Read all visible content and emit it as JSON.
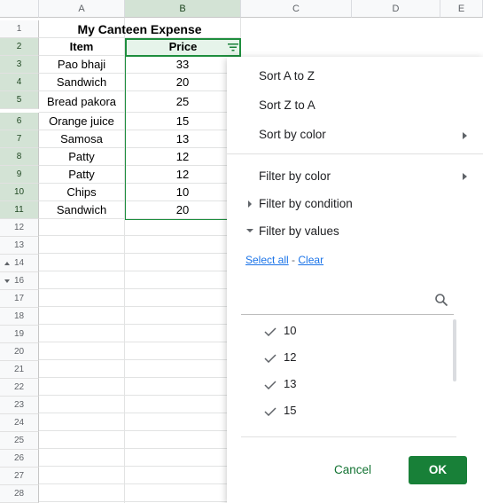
{
  "columns": [
    "A",
    "B",
    "C",
    "D",
    "E"
  ],
  "row_numbers": [
    "1",
    "2",
    "3",
    "4",
    "5",
    "6",
    "7",
    "8",
    "9",
    "10",
    "11",
    "12",
    "13",
    "14",
    "16",
    "17",
    "18",
    "19",
    "20",
    "21",
    "22",
    "23",
    "24",
    "25",
    "26",
    "27",
    "28"
  ],
  "sheet": {
    "title": "My Canteen Expense",
    "headers": {
      "item": "Item",
      "price": "Price"
    },
    "rows": [
      {
        "item": "Pao bhaji",
        "price": "33"
      },
      {
        "item": "Sandwich",
        "price": "20"
      },
      {
        "item": "Bread pakora",
        "price": "25"
      },
      {
        "item": "Orange juice",
        "price": "15"
      },
      {
        "item": "Samosa",
        "price": "13"
      },
      {
        "item": "Patty",
        "price": "12"
      },
      {
        "item": "Patty",
        "price": "12"
      },
      {
        "item": "Chips",
        "price": "10"
      },
      {
        "item": "Sandwich",
        "price": "20"
      }
    ]
  },
  "filter_menu": {
    "sort_az": "Sort A to Z",
    "sort_za": "Sort Z to A",
    "sort_by_color": "Sort by color",
    "filter_by_color": "Filter by color",
    "filter_by_condition": "Filter by condition",
    "filter_by_values": "Filter by values",
    "select_all": "Select all",
    "separator": "-",
    "clear": "Clear",
    "values": [
      "10",
      "12",
      "13",
      "15"
    ],
    "cancel": "Cancel",
    "ok": "OK"
  },
  "colors": {
    "accent_green": "#188038",
    "selection": "#1e8e3e",
    "link": "#1a73e8"
  },
  "icons": [
    "filter-icon",
    "search-icon",
    "check-icon",
    "triangle-right-icon",
    "triangle-down-icon"
  ]
}
